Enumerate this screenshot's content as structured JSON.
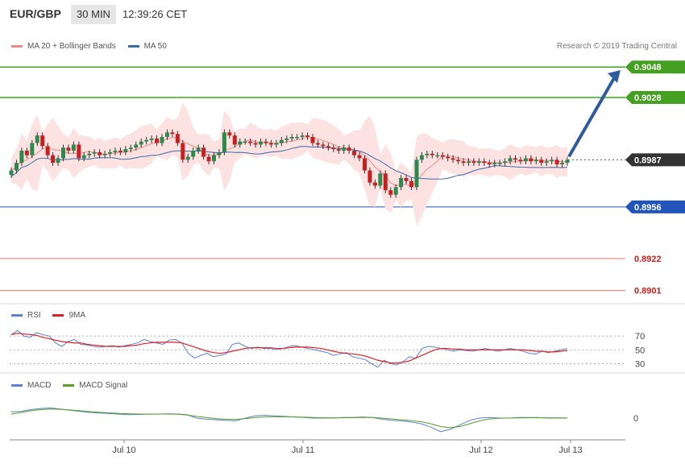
{
  "header": {
    "pair": "EUR/GBP",
    "timeframe": "30 MIN",
    "time": "12:39:26 CET"
  },
  "legend_main": [
    {
      "label": "MA 20 + Bollinger Bands",
      "color": "#f08a8a"
    },
    {
      "label": "MA 50",
      "color": "#3a6aa8"
    }
  ],
  "copyright": "Research © 2019 Trading Central",
  "legend_rsi": [
    {
      "label": "RSI",
      "color": "#5b7fd6"
    },
    {
      "label": "9MA",
      "color": "#e02020"
    }
  ],
  "legend_macd": [
    {
      "label": "MACD",
      "color": "#5b7fd6"
    },
    {
      "label": "MACD Signal",
      "color": "#55a020"
    }
  ],
  "colors": {
    "up": "#2d8a4e",
    "down": "#c82020",
    "resistance": "#44a020",
    "support_blue": "#2255bb",
    "support_red": "#e87070",
    "arrow": "#2e5aa0",
    "band": "#fde2e2"
  },
  "chart_data": {
    "type": "candlestick",
    "price_axis": {
      "min": 0.8895,
      "max": 0.9055
    },
    "levels": [
      {
        "value": 0.9048,
        "label": "0.9048",
        "kind": "resistance"
      },
      {
        "value": 0.9028,
        "label": "0.9028",
        "kind": "resistance"
      },
      {
        "value": 0.8987,
        "label": "0.8987",
        "kind": "current"
      },
      {
        "value": 0.8956,
        "label": "0.8956",
        "kind": "support"
      },
      {
        "value": 0.8922,
        "label": "0.8922",
        "kind": "support2"
      },
      {
        "value": 0.8901,
        "label": "0.8901",
        "kind": "support2"
      }
    ],
    "x_labels": [
      "Jul 10",
      "Jul 11",
      "Jul 12",
      "Jul 13"
    ],
    "close_series": [
      0.898,
      0.8985,
      0.8993,
      0.899,
      0.8998,
      0.9003,
      0.8996,
      0.899,
      0.8985,
      0.8988,
      0.8995,
      0.8993,
      0.8997,
      0.8988,
      0.899,
      0.8991,
      0.8992,
      0.899,
      0.8991,
      0.8992,
      0.8993,
      0.8992,
      0.8994,
      0.8995,
      0.8997,
      0.8999,
      0.9,
      0.9001,
      0.8998,
      0.9002,
      0.9005,
      0.9004,
      0.8998,
      0.8987,
      0.8989,
      0.8993,
      0.8995,
      0.8989,
      0.8986,
      0.899,
      0.8992,
      0.9005,
      0.9003,
      0.8997,
      0.8999,
      0.8999,
      0.8998,
      0.8997,
      0.8999,
      0.8998,
      0.8997,
      0.8998,
      0.9,
      0.9001,
      0.9002,
      0.9002,
      0.9003,
      0.9002,
      0.8998,
      0.8997,
      0.8996,
      0.8995,
      0.8994,
      0.8993,
      0.8995,
      0.8993,
      0.899,
      0.8988,
      0.898,
      0.8972,
      0.897,
      0.8978,
      0.8967,
      0.8964,
      0.8969,
      0.8975,
      0.8973,
      0.8969,
      0.8987,
      0.899,
      0.8991,
      0.899,
      0.899,
      0.8989,
      0.8988,
      0.8987,
      0.8986,
      0.8985,
      0.8986,
      0.8985,
      0.8986,
      0.8985,
      0.8984,
      0.8985,
      0.8985,
      0.8986,
      0.8988,
      0.8987,
      0.8986,
      0.8988,
      0.8986,
      0.8987,
      0.8985,
      0.8986,
      0.8987,
      0.8984,
      0.8985,
      0.8987
    ],
    "rsi": {
      "ticks": [
        70,
        50,
        30
      ],
      "values": [
        72,
        78,
        70,
        68,
        75,
        72,
        70,
        60,
        55,
        62,
        65,
        58,
        57,
        55,
        54,
        55,
        56,
        54,
        56,
        58,
        60,
        65,
        62,
        60,
        58,
        64,
        65,
        60,
        45,
        38,
        42,
        45,
        40,
        42,
        44,
        58,
        60,
        55,
        52,
        54,
        52,
        52,
        50,
        52,
        55,
        56,
        54,
        52,
        50,
        48,
        46,
        42,
        44,
        46,
        40,
        38,
        36,
        30,
        25,
        35,
        30,
        28,
        33,
        40,
        38,
        52,
        55,
        54,
        52,
        50,
        48,
        50,
        49,
        48,
        50,
        52,
        50,
        48,
        50,
        52,
        50,
        48,
        45,
        44,
        48,
        46,
        48,
        50,
        52
      ]
    },
    "rsi_ma": [
      72,
      74,
      73,
      72,
      71,
      68,
      66,
      64,
      62,
      61,
      60,
      60,
      58,
      57,
      56,
      55,
      55,
      55,
      55,
      56,
      57,
      59,
      60,
      61,
      61,
      61,
      61,
      60,
      57,
      54,
      51,
      48,
      46,
      45,
      46,
      48,
      50,
      52,
      53,
      53,
      53,
      53,
      52,
      52,
      53,
      54,
      54,
      54,
      53,
      52,
      50,
      48,
      46,
      45,
      44,
      43,
      41,
      38,
      35,
      33,
      31,
      31,
      32,
      34,
      38,
      42,
      46,
      50,
      52,
      52,
      51,
      51,
      50,
      50,
      50,
      50,
      50,
      50,
      50,
      50,
      50,
      50,
      49,
      48,
      48,
      47,
      47,
      48,
      49
    ],
    "macd": {
      "zero_label": "0",
      "values": [
        0.55,
        0.6,
        0.75,
        0.85,
        0.9,
        0.8,
        0.7,
        0.6,
        0.5,
        0.45,
        0.4,
        0.35,
        0.3,
        0.32,
        0.35,
        0.35,
        0.38,
        0.36,
        0.3,
        0.0,
        -0.1,
        -0.15,
        -0.2,
        -0.25,
        0.0,
        0.2,
        0.25,
        0.2,
        0.15,
        0.1,
        0.05,
        0.0,
        0.0,
        0.0,
        0.05,
        0.05,
        0.1,
        0.05,
        -0.1,
        -0.2,
        -0.25,
        -0.35,
        -0.5,
        -0.8,
        -1.2,
        -1.0,
        -0.6,
        -0.2,
        0.0,
        0.05,
        0.0,
        0.0,
        0.05,
        0.05,
        0.05,
        0.0,
        0.0,
        0.0
      ]
    },
    "macd_signal": [
      0.35,
      0.5,
      0.65,
      0.75,
      0.8,
      0.78,
      0.72,
      0.65,
      0.58,
      0.52,
      0.46,
      0.42,
      0.38,
      0.36,
      0.36,
      0.36,
      0.36,
      0.34,
      0.28,
      0.15,
      0.05,
      -0.05,
      -0.1,
      -0.12,
      -0.05,
      0.05,
      0.1,
      0.12,
      0.12,
      0.1,
      0.08,
      0.05,
      0.03,
      0.02,
      0.03,
      0.04,
      0.06,
      0.05,
      0.0,
      -0.08,
      -0.15,
      -0.22,
      -0.32,
      -0.5,
      -0.75,
      -0.85,
      -0.75,
      -0.5,
      -0.25,
      -0.08,
      -0.02,
      0.0,
      0.02,
      0.03,
      0.04,
      0.03,
      0.02,
      0.02
    ]
  }
}
